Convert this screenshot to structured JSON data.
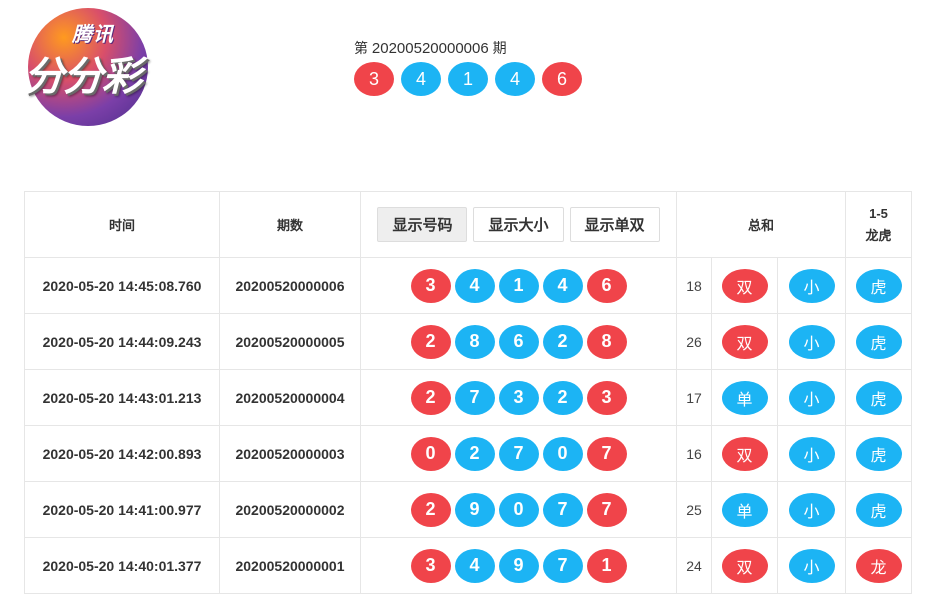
{
  "logo": {
    "small_text": "腾讯",
    "big_text": "分分彩"
  },
  "current": {
    "prefix": "第",
    "issue": "20200520000006",
    "suffix": "期",
    "balls": [
      {
        "n": "3",
        "c": "red"
      },
      {
        "n": "4",
        "c": "blue"
      },
      {
        "n": "1",
        "c": "blue"
      },
      {
        "n": "4",
        "c": "blue"
      },
      {
        "n": "6",
        "c": "red"
      }
    ]
  },
  "table": {
    "headers": {
      "time": "时间",
      "issue": "期数",
      "btn_number": "显示号码",
      "btn_size": "显示大小",
      "btn_oddeven": "显示单双",
      "sum": "总和",
      "dragon_tiger_line1": "1-5",
      "dragon_tiger_line2": "龙虎"
    },
    "rows": [
      {
        "time": "2020-05-20 14:45:08.760",
        "issue": "20200520000006",
        "balls": [
          {
            "n": "3",
            "c": "red"
          },
          {
            "n": "4",
            "c": "blue"
          },
          {
            "n": "1",
            "c": "blue"
          },
          {
            "n": "4",
            "c": "blue"
          },
          {
            "n": "6",
            "c": "red"
          }
        ],
        "sum": "18",
        "oe": {
          "t": "双",
          "c": "red"
        },
        "bs": {
          "t": "小",
          "c": "blue"
        },
        "dt": {
          "t": "虎",
          "c": "blue"
        }
      },
      {
        "time": "2020-05-20 14:44:09.243",
        "issue": "20200520000005",
        "balls": [
          {
            "n": "2",
            "c": "red"
          },
          {
            "n": "8",
            "c": "blue"
          },
          {
            "n": "6",
            "c": "blue"
          },
          {
            "n": "2",
            "c": "blue"
          },
          {
            "n": "8",
            "c": "red"
          }
        ],
        "sum": "26",
        "oe": {
          "t": "双",
          "c": "red"
        },
        "bs": {
          "t": "小",
          "c": "blue"
        },
        "dt": {
          "t": "虎",
          "c": "blue"
        }
      },
      {
        "time": "2020-05-20 14:43:01.213",
        "issue": "20200520000004",
        "balls": [
          {
            "n": "2",
            "c": "red"
          },
          {
            "n": "7",
            "c": "blue"
          },
          {
            "n": "3",
            "c": "blue"
          },
          {
            "n": "2",
            "c": "blue"
          },
          {
            "n": "3",
            "c": "red"
          }
        ],
        "sum": "17",
        "oe": {
          "t": "单",
          "c": "blue"
        },
        "bs": {
          "t": "小",
          "c": "blue"
        },
        "dt": {
          "t": "虎",
          "c": "blue"
        }
      },
      {
        "time": "2020-05-20 14:42:00.893",
        "issue": "20200520000003",
        "balls": [
          {
            "n": "0",
            "c": "red"
          },
          {
            "n": "2",
            "c": "blue"
          },
          {
            "n": "7",
            "c": "blue"
          },
          {
            "n": "0",
            "c": "blue"
          },
          {
            "n": "7",
            "c": "red"
          }
        ],
        "sum": "16",
        "oe": {
          "t": "双",
          "c": "red"
        },
        "bs": {
          "t": "小",
          "c": "blue"
        },
        "dt": {
          "t": "虎",
          "c": "blue"
        }
      },
      {
        "time": "2020-05-20 14:41:00.977",
        "issue": "20200520000002",
        "balls": [
          {
            "n": "2",
            "c": "red"
          },
          {
            "n": "9",
            "c": "blue"
          },
          {
            "n": "0",
            "c": "blue"
          },
          {
            "n": "7",
            "c": "blue"
          },
          {
            "n": "7",
            "c": "red"
          }
        ],
        "sum": "25",
        "oe": {
          "t": "单",
          "c": "blue"
        },
        "bs": {
          "t": "小",
          "c": "blue"
        },
        "dt": {
          "t": "虎",
          "c": "blue"
        }
      },
      {
        "time": "2020-05-20 14:40:01.377",
        "issue": "20200520000001",
        "balls": [
          {
            "n": "3",
            "c": "red"
          },
          {
            "n": "4",
            "c": "blue"
          },
          {
            "n": "9",
            "c": "blue"
          },
          {
            "n": "7",
            "c": "blue"
          },
          {
            "n": "1",
            "c": "red"
          }
        ],
        "sum": "24",
        "oe": {
          "t": "双",
          "c": "red"
        },
        "bs": {
          "t": "小",
          "c": "blue"
        },
        "dt": {
          "t": "龙",
          "c": "red"
        }
      }
    ]
  }
}
